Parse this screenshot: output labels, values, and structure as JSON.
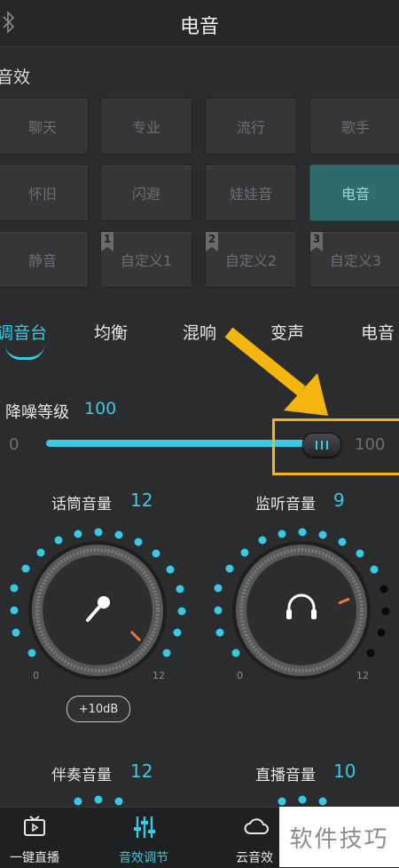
{
  "header": {
    "title": "电音"
  },
  "section": {
    "label": "音效"
  },
  "presets": [
    {
      "label": "聊天",
      "active": false,
      "badge": ""
    },
    {
      "label": "专业",
      "active": false,
      "badge": ""
    },
    {
      "label": "流行",
      "active": false,
      "badge": ""
    },
    {
      "label": "歌手",
      "active": false,
      "badge": ""
    },
    {
      "label": "怀旧",
      "active": false,
      "badge": ""
    },
    {
      "label": "闪避",
      "active": false,
      "badge": ""
    },
    {
      "label": "娃娃音",
      "active": false,
      "badge": ""
    },
    {
      "label": "电音",
      "active": true,
      "badge": ""
    },
    {
      "label": "静音",
      "active": false,
      "badge": ""
    },
    {
      "label": "自定义1",
      "active": false,
      "badge": "1"
    },
    {
      "label": "自定义2",
      "active": false,
      "badge": "2"
    },
    {
      "label": "自定义3",
      "active": false,
      "badge": "3"
    }
  ],
  "tabs": [
    {
      "label": "调音台",
      "active": true
    },
    {
      "label": "均衡",
      "active": false
    },
    {
      "label": "混响",
      "active": false
    },
    {
      "label": "变声",
      "active": false
    },
    {
      "label": "电音",
      "active": false
    }
  ],
  "noise": {
    "label": "降噪等级",
    "value": "100",
    "min": "0",
    "max": "100",
    "level": 1.0
  },
  "knobs": {
    "mic": {
      "label": "话筒音量",
      "value": "12",
      "min": "0",
      "max": "12",
      "icon": "microphone-icon"
    },
    "monitor": {
      "label": "监听音量",
      "value": "9",
      "min": "0",
      "max": "12",
      "icon": "headphones-icon"
    },
    "accomp": {
      "label": "伴奏音量",
      "value": "12"
    },
    "live": {
      "label": "直播音量",
      "value": "10"
    }
  },
  "boost_button": "+10dB",
  "nav": [
    {
      "label": "一键直播",
      "icon": "tv-icon",
      "active": false
    },
    {
      "label": "音效调节",
      "icon": "sliders-icon",
      "active": true
    },
    {
      "label": "云音效",
      "icon": "cloud-icon",
      "active": false
    }
  ],
  "watermark": "软件技巧",
  "colors": {
    "accent": "#38c9e5",
    "highlight": "#f5b50f",
    "active_preset": "#2f6a6c",
    "indicator": "#f07a2a"
  }
}
